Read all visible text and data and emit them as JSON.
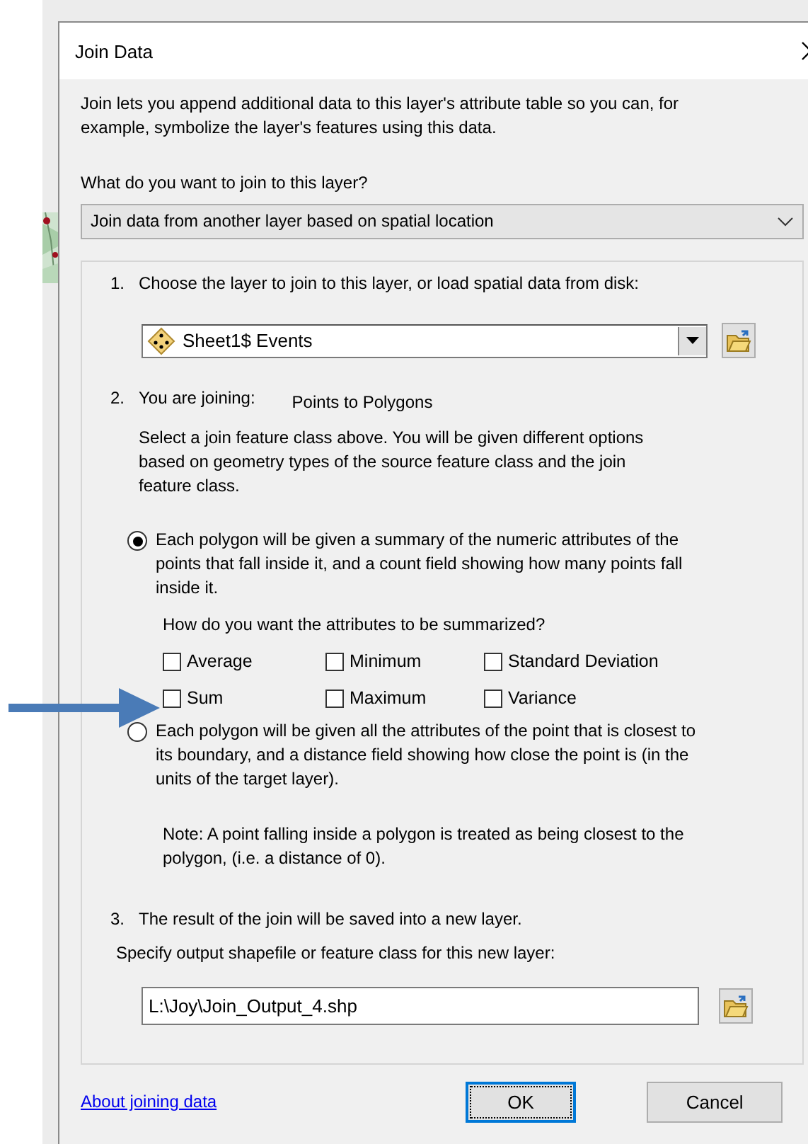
{
  "window": {
    "title": "Join Data"
  },
  "intro": "Join lets you append additional data to this layer's attribute table so you can, for example, symbolize the layer's features using this data.",
  "join_type": {
    "label": "What do you want to join to this layer?",
    "value": "Join data from another layer based on spatial location"
  },
  "step1": {
    "number": "1.",
    "label": "Choose the layer to join to this layer, or load spatial data from disk:",
    "layer": "Sheet1$ Events"
  },
  "step2": {
    "number": "2.",
    "label": "You are joining:",
    "join_kind": "Points to Polygons",
    "description": "Select a join feature class above.  You will be given different options based on geometry types of the source feature class and the join feature class.",
    "options": [
      {
        "selected": true,
        "text": "Each polygon will be given a summary of the numeric attributes of the points that fall inside it, and a count field showing how many points fall inside it.",
        "question": "How do you want the attributes to be summarized?",
        "checkboxes": [
          {
            "label": "Average",
            "checked": false
          },
          {
            "label": "Minimum",
            "checked": false
          },
          {
            "label": "Standard Deviation",
            "checked": false
          },
          {
            "label": "Sum",
            "checked": false
          },
          {
            "label": "Maximum",
            "checked": false
          },
          {
            "label": "Variance",
            "checked": false
          }
        ]
      },
      {
        "selected": false,
        "text": "Each polygon will be given all the attributes of the point that is closest to its boundary, and a distance field showing how close the point is (in the units of the target layer).",
        "note": "Note: A point falling inside a polygon is treated as being closest to the polygon, (i.e. a distance of 0)."
      }
    ]
  },
  "step3": {
    "number": "3.",
    "label": "The result of the join will be saved into a new layer.",
    "prompt": "Specify output shapefile or feature class for this new layer:",
    "output_path": "L:\\Joy\\Join_Output_4.shp"
  },
  "footer": {
    "link": "About joining data",
    "buttons": [
      {
        "label": "OK",
        "default": true
      },
      {
        "label": "Cancel",
        "default": false
      }
    ]
  }
}
